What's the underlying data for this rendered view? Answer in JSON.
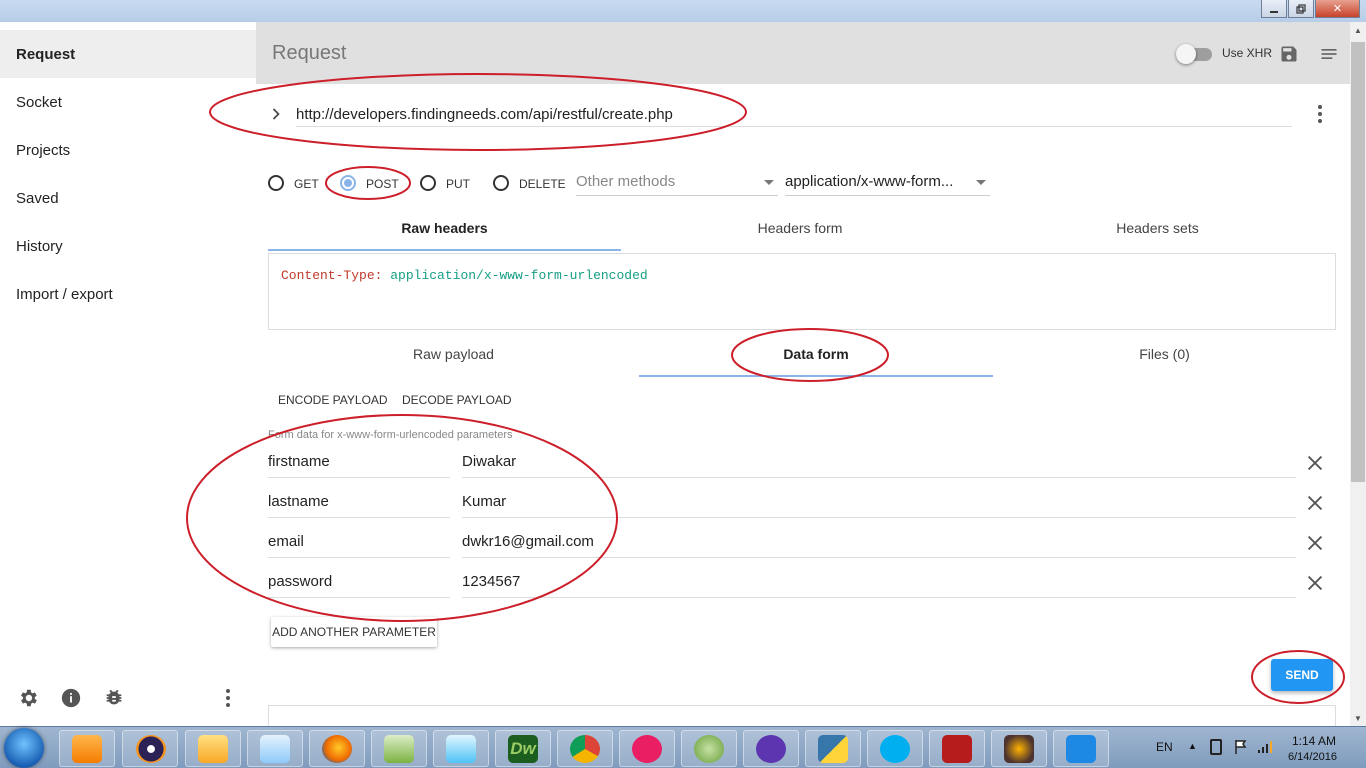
{
  "window": {
    "controls": [
      "minimize",
      "maximize",
      "close"
    ],
    "close_glyph": "✕"
  },
  "sidebar": {
    "items": [
      {
        "label": "Request",
        "active": true
      },
      {
        "label": "Socket"
      },
      {
        "label": "Projects"
      },
      {
        "label": "Saved"
      },
      {
        "label": "History"
      },
      {
        "label": "Import / export"
      }
    ],
    "bottom_icons": [
      "gear-icon",
      "info-icon",
      "bug-icon",
      "more-vert-icon"
    ]
  },
  "topbar": {
    "title": "Request",
    "xhr_label": "Use XHR",
    "xhr_enabled": false,
    "icons": [
      "save-icon",
      "menu-icon"
    ]
  },
  "request": {
    "url": "http://developers.findingneeds.com/api/restful/create.php",
    "methods": [
      {
        "label": "GET",
        "checked": false
      },
      {
        "label": "POST",
        "checked": true
      },
      {
        "label": "PUT",
        "checked": false
      },
      {
        "label": "DELETE",
        "checked": false
      }
    ],
    "other_methods_placeholder": "Other methods",
    "content_type": "application/x-www-form...",
    "header_tabs": [
      "Raw headers",
      "Headers form",
      "Headers sets"
    ],
    "active_header_tab": "Raw headers",
    "raw_headers": {
      "key": "Content-Type:",
      "value": "application/x-www-form-urlencoded"
    },
    "payload_tabs": [
      "Raw payload",
      "Data form",
      "Files (0)"
    ],
    "active_payload_tab": "Data form",
    "encode_label": "ENCODE PAYLOAD",
    "decode_label": "DECODE PAYLOAD",
    "form_hint": "Form data for x-www-form-urlencoded parameters",
    "params": [
      {
        "name": "firstname",
        "value": "Diwakar"
      },
      {
        "name": "lastname",
        "value": "Kumar"
      },
      {
        "name": "email",
        "value": "dwkr16@gmail.com"
      },
      {
        "name": "password",
        "value": "1234567"
      }
    ],
    "add_param_label": "ADD ANOTHER PARAMETER",
    "send_label": "SEND"
  },
  "colors": {
    "accent": "#8ab4e8",
    "send": "#2196f3",
    "annotation": "#cc1f2a",
    "header_key": "#c0392b",
    "header_value": "#16a085"
  },
  "taskbar": {
    "apps": [
      "media-player-icon",
      "eclipse-icon",
      "file-explorer-icon",
      "notepad-icon",
      "firefox-icon",
      "notepad-plus-icon",
      "remote-desktop-icon",
      "dreamweaver-icon",
      "chrome-icon",
      "wamp-icon",
      "android-studio-icon",
      "github-icon",
      "python-icon",
      "skype-icon",
      "filezilla-icon",
      "javaee-ide-icon",
      "upload-icon"
    ],
    "dreamweaver_label": "Dw",
    "language": "EN",
    "time": "1:14 AM",
    "date": "6/14/2016"
  }
}
